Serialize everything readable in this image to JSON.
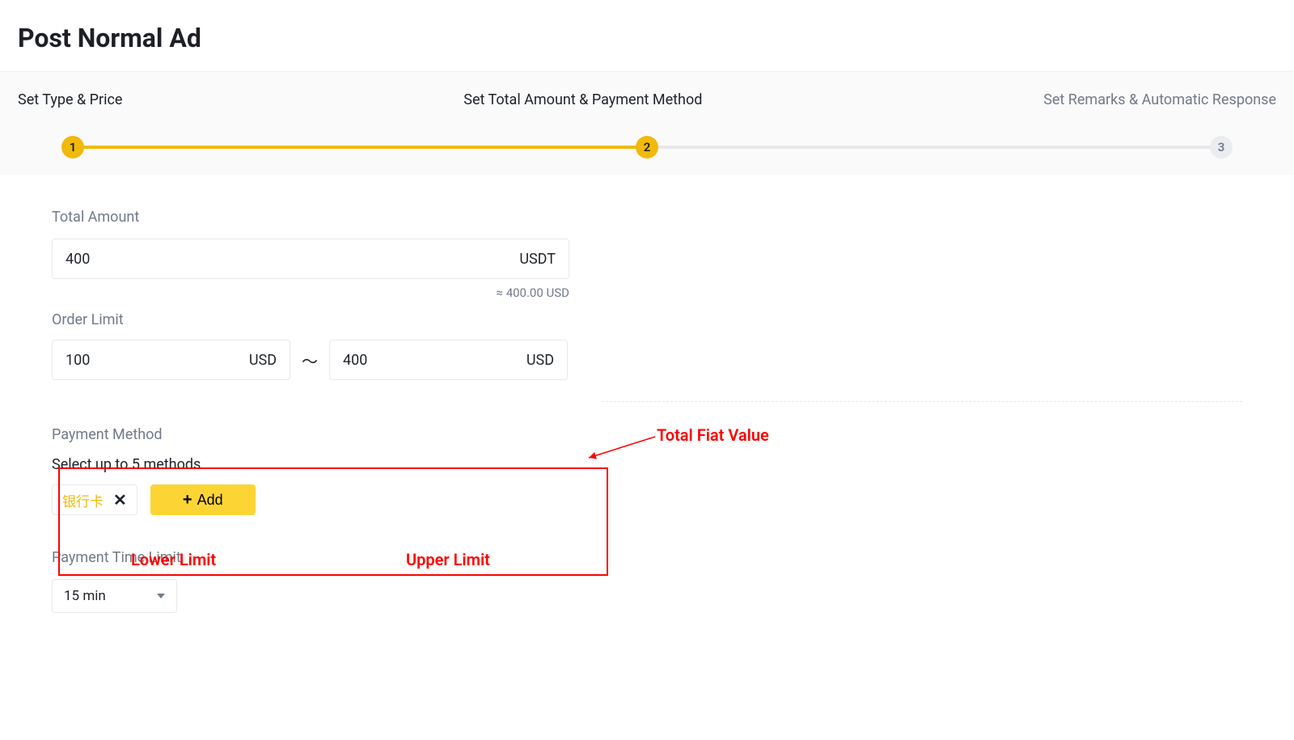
{
  "page": {
    "title": "Post Normal Ad"
  },
  "stepper": {
    "steps": [
      {
        "num": "1",
        "label": "Set Type & Price"
      },
      {
        "num": "2",
        "label": "Set Total Amount & Payment Method"
      },
      {
        "num": "3",
        "label": "Set Remarks & Automatic Response"
      }
    ],
    "active_index": 1
  },
  "total_amount": {
    "label": "Total Amount",
    "value": "400",
    "currency": "USDT",
    "approx": "≈ 400.00 USD"
  },
  "order_limit": {
    "label": "Order Limit",
    "lower": {
      "value": "100",
      "currency": "USD"
    },
    "upper": {
      "value": "400",
      "currency": "USD"
    },
    "separator": "～"
  },
  "payment_method": {
    "label": "Payment Method",
    "hint": "Select up to 5 methods",
    "chips": [
      {
        "text": "银行卡"
      }
    ],
    "add_label": "Add"
  },
  "payment_time_limit": {
    "label": "Payment Time Limit",
    "value": "15 min"
  },
  "annotations": {
    "total_fiat": "Total Fiat Value",
    "lower_limit": "Lower Limit",
    "upper_limit": "Upper Limit"
  }
}
